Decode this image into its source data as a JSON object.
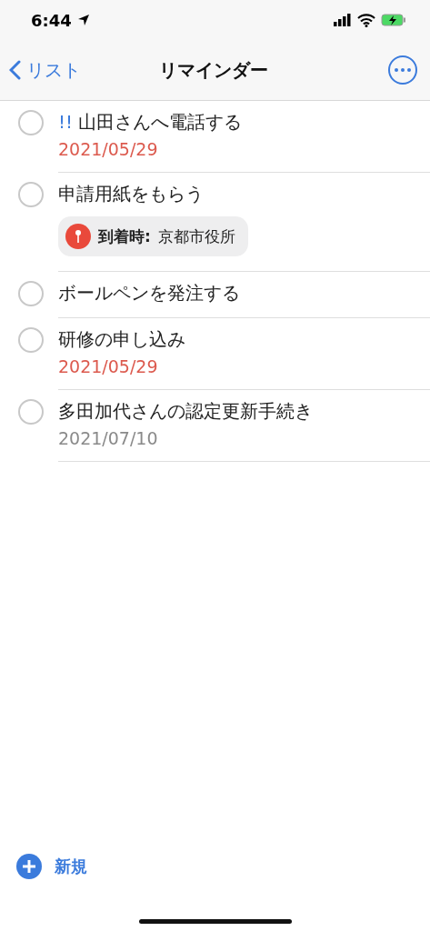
{
  "status_bar": {
    "time": "6:44"
  },
  "nav": {
    "back": "リスト",
    "title": "リマインダー"
  },
  "reminders": [
    {
      "priority": "!!",
      "title": "山田さんへ電話する",
      "checked": false,
      "date": "2021/05/29",
      "overdue": true
    },
    {
      "title": "申請用紙をもらう",
      "checked": false,
      "location": {
        "label": "到着時:",
        "place": "京都市役所"
      }
    },
    {
      "title": "ボールペンを発注する",
      "checked": false
    },
    {
      "title": "研修の申し込み",
      "checked": false,
      "date": "2021/05/29",
      "overdue": true
    },
    {
      "title": "多田加代さんの認定更新手続き",
      "checked": false,
      "date": "2021/07/10",
      "overdue": false
    }
  ],
  "new_button": "新規"
}
